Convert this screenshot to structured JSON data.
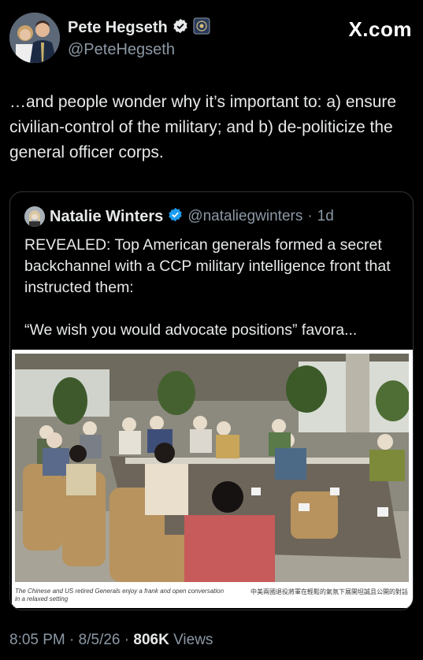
{
  "post": {
    "author_name": "Pete Hegseth",
    "author_handle": "@PeteHegseth",
    "brand": "X.com",
    "text": "…and people wonder why it’s important to: a) ensure civilian-control of the military; and b) de-politicize the general officer corps."
  },
  "quote": {
    "author_name": "Natalie Winters",
    "author_handle": "@nataliegwinters",
    "separator": "·",
    "age": "1d",
    "paragraph_1": "REVEALED: Top American generals formed a secret backchannel with a CCP military intelligence front that instructed them:",
    "paragraph_2": "“We wish you would advocate positions” favora...",
    "caption_left": "The Chinese and US retired Generals enjoy a frank and open conversation in a relaxed setting",
    "caption_right": "中美兩國退役將軍在輕鬆的氣氛下展開坦誠且公開的對話"
  },
  "meta": {
    "time": "8:05 PM",
    "date": "8/5/26",
    "views_count": "806K",
    "views_label": "Views",
    "separator": "·"
  },
  "colors": {
    "background": "#000000",
    "text_primary": "#e7e9ea",
    "text_secondary": "#8b98a5",
    "verified_blue": "#1d9bf0",
    "border": "#2f3336"
  },
  "icons": [
    "verified-badge-icon",
    "government-affiliation-icon"
  ]
}
